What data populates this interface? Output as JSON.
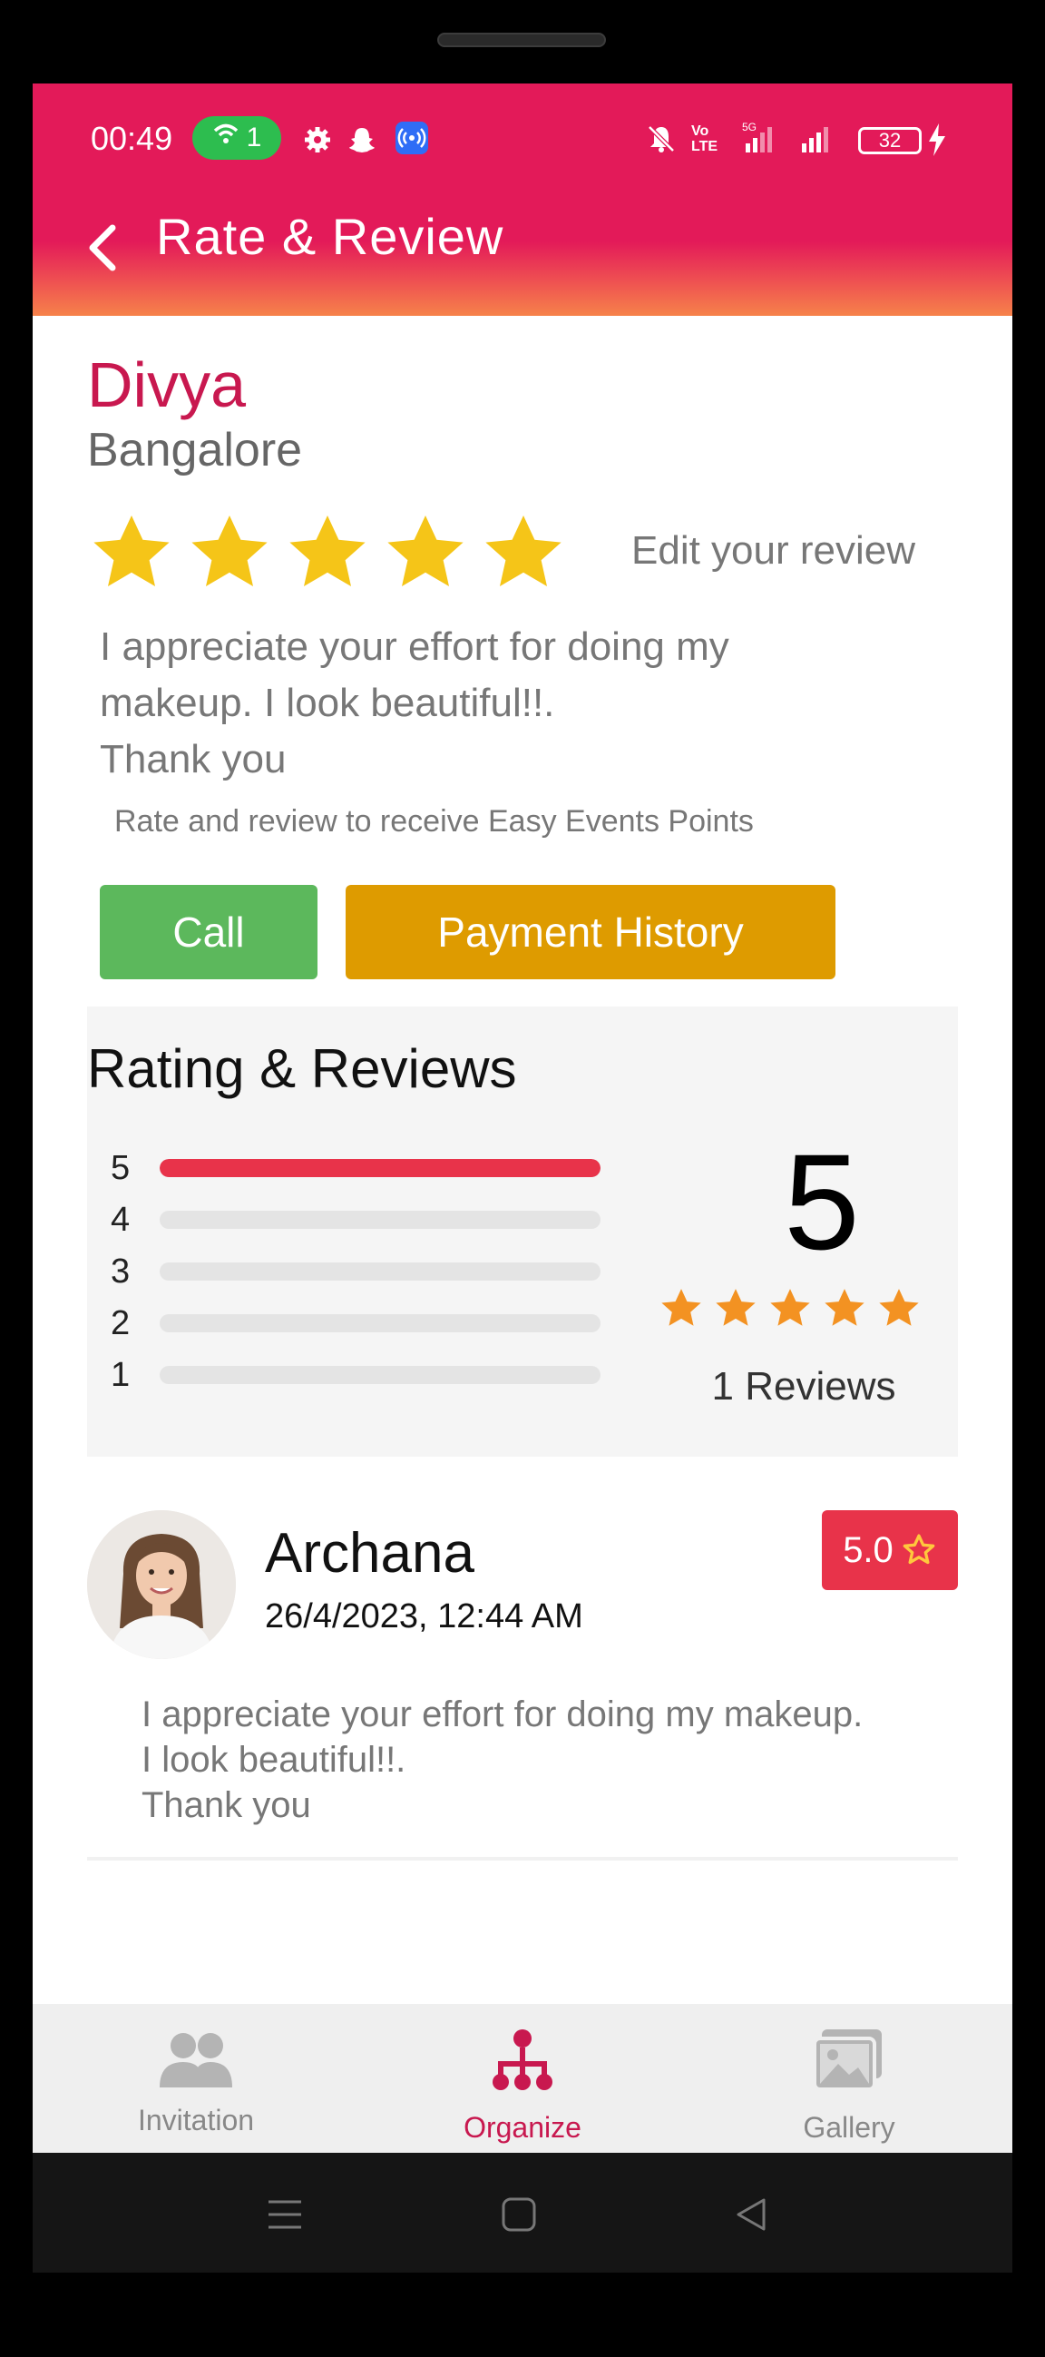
{
  "status_bar": {
    "time": "00:49",
    "wifi_count": "1",
    "battery": "32",
    "icons": [
      "wifi-icon",
      "settings-icon",
      "snapchat-icon",
      "hotspot-icon",
      "mute-icon",
      "volte-icon",
      "5g-signal-icon",
      "signal-icon",
      "battery-icon",
      "charging-icon"
    ]
  },
  "header": {
    "title": "Rate & Review",
    "back_icon": "back-arrow-icon"
  },
  "vendor": {
    "name": "Divya",
    "city": "Bangalore",
    "rating": 5,
    "rating_max": 5
  },
  "my_review": {
    "edit_label": "Edit your review",
    "text": "I appreciate your effort for doing my\nmakeup. I look beautiful!!.\nThank you",
    "points_note": "Rate and review to receive Easy Events Points"
  },
  "actions": {
    "call_label": "Call",
    "payment_label": "Payment History"
  },
  "rating_summary": {
    "title": "Rating & Reviews",
    "bars": [
      {
        "label": "5",
        "fraction": 1.0
      },
      {
        "label": "4",
        "fraction": 0.0
      },
      {
        "label": "3",
        "fraction": 0.0
      },
      {
        "label": "2",
        "fraction": 0.0
      },
      {
        "label": "1",
        "fraction": 0.0
      }
    ],
    "score": "5",
    "stars": 5,
    "reviews_label": "1 Reviews"
  },
  "reviews": [
    {
      "name": "Archana",
      "date": "26/4/2023, 12:44 AM",
      "score": "5.0",
      "text": "I appreciate your effort for doing my makeup.\nI look beautiful!!.\nThank you"
    }
  ],
  "bottom_nav": {
    "items": [
      {
        "label": "Invitation",
        "icon": "people-icon",
        "active": false
      },
      {
        "label": "Organize",
        "icon": "org-chart-icon",
        "active": true
      },
      {
        "label": "Gallery",
        "icon": "gallery-icon",
        "active": false
      }
    ]
  },
  "colors": {
    "brand": "#e31a59",
    "accent_red": "#e8334a",
    "star_gold": "#f5c518",
    "star_orange": "#f39222",
    "call_green": "#5cb85c",
    "payment_amber": "#de9b00"
  },
  "system_nav": {
    "icons": [
      "menu-icon",
      "home-icon",
      "back-icon"
    ]
  }
}
